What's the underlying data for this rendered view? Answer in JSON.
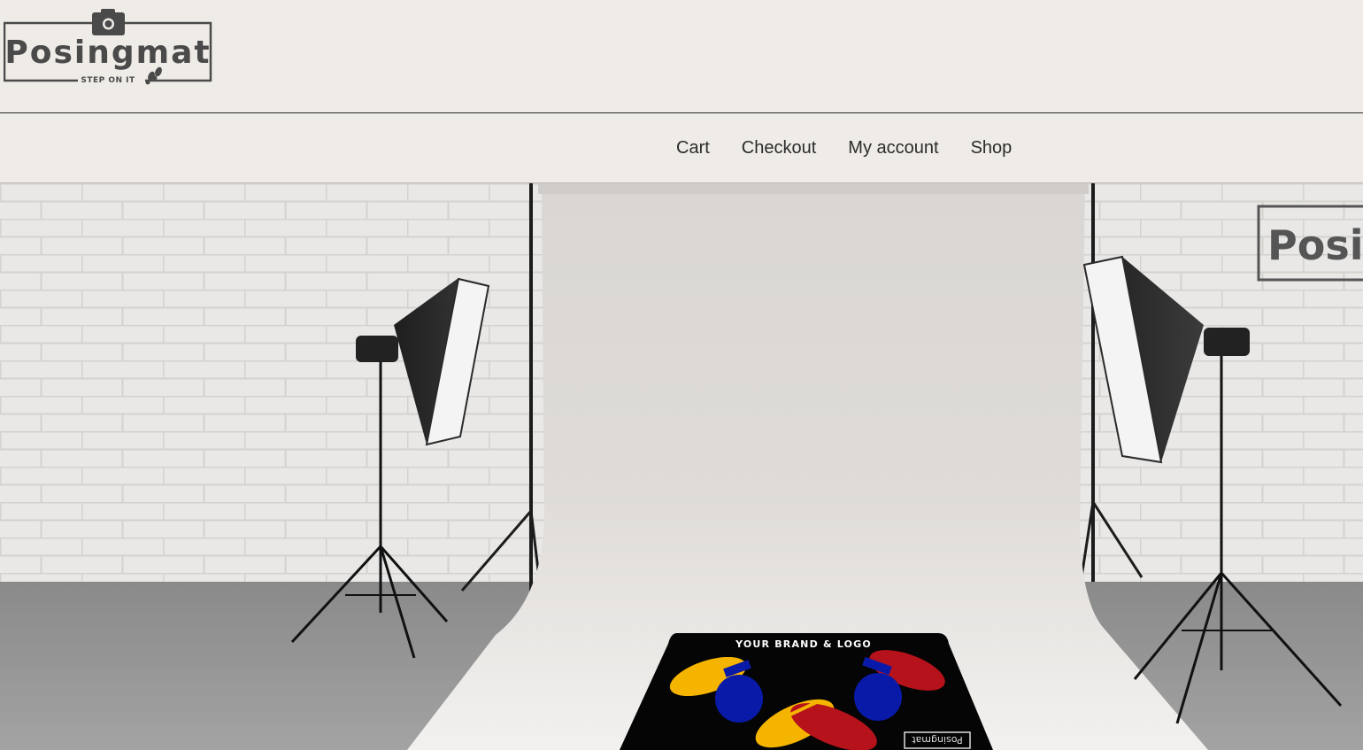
{
  "brand": {
    "name": "Posingmat",
    "tagline": "STEP ON IT",
    "icons": [
      "camera-icon",
      "footprints-icon"
    ]
  },
  "nav": {
    "items": [
      {
        "label": "Cart",
        "name": "nav-cart"
      },
      {
        "label": "Checkout",
        "name": "nav-checkout"
      },
      {
        "label": "My account",
        "name": "nav-my-account"
      },
      {
        "label": "Shop",
        "name": "nav-shop"
      }
    ]
  },
  "hero": {
    "mat_text": "YOUR BRAND & LOGO",
    "mat_logo_text": "Posingmat",
    "wall_sign_text": "Posi"
  },
  "colors": {
    "background": "#efece7",
    "text": "#2b2b2b",
    "logo_gray": "#4a4a4a",
    "mat_yellow": "#f4b400",
    "mat_blue": "#0a1aa8",
    "mat_red": "#b5121b"
  }
}
